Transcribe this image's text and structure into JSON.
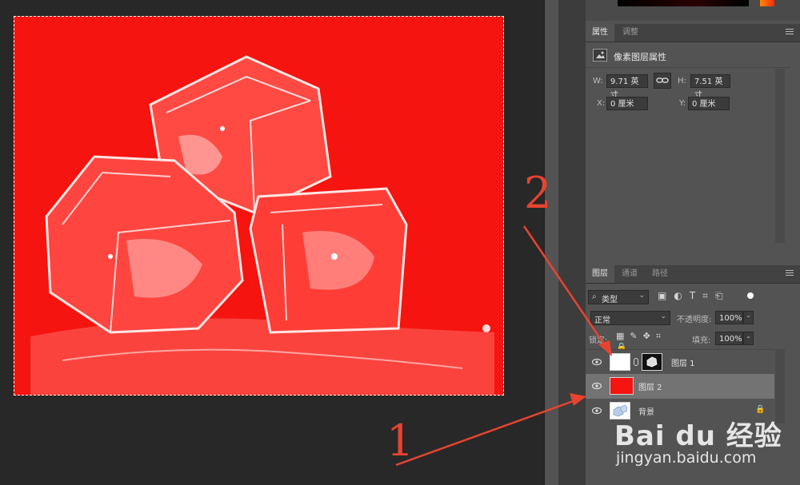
{
  "properties_panel": {
    "tabs": [
      "属性",
      "调整"
    ],
    "section_title": "像素图层属性",
    "w_label": "W:",
    "w_value": "9.71 英寸",
    "h_label": "H:",
    "h_value": "7.51 英寸",
    "x_label": "X:",
    "x_value": "0 厘米",
    "y_label": "Y:",
    "y_value": "0 厘米"
  },
  "layers_panel": {
    "tabs": [
      "图层",
      "通道",
      "路径"
    ],
    "filter_kind": "类型",
    "blend_mode": "正常",
    "opacity_label": "不透明度:",
    "opacity_value": "100%",
    "lock_label": "锁定:",
    "fill_label": "填充:",
    "fill_value": "100%",
    "layers": [
      {
        "name": "图层 1",
        "type": "with-mask",
        "selected": false
      },
      {
        "name": "图层 2",
        "type": "solid-red",
        "selected": true
      },
      {
        "name": "背景",
        "type": "image",
        "locked": true,
        "selected": false
      }
    ]
  },
  "annotations": {
    "label_1": "1",
    "label_2": "2",
    "arrow_color": "#e8432f"
  },
  "watermark": {
    "brand": "Bai du 经验",
    "url": "jingyan.baidu.com"
  },
  "colors": {
    "canvas_fill": "#f5140f",
    "panel_bg": "#535353",
    "workspace_bg": "#282828"
  }
}
